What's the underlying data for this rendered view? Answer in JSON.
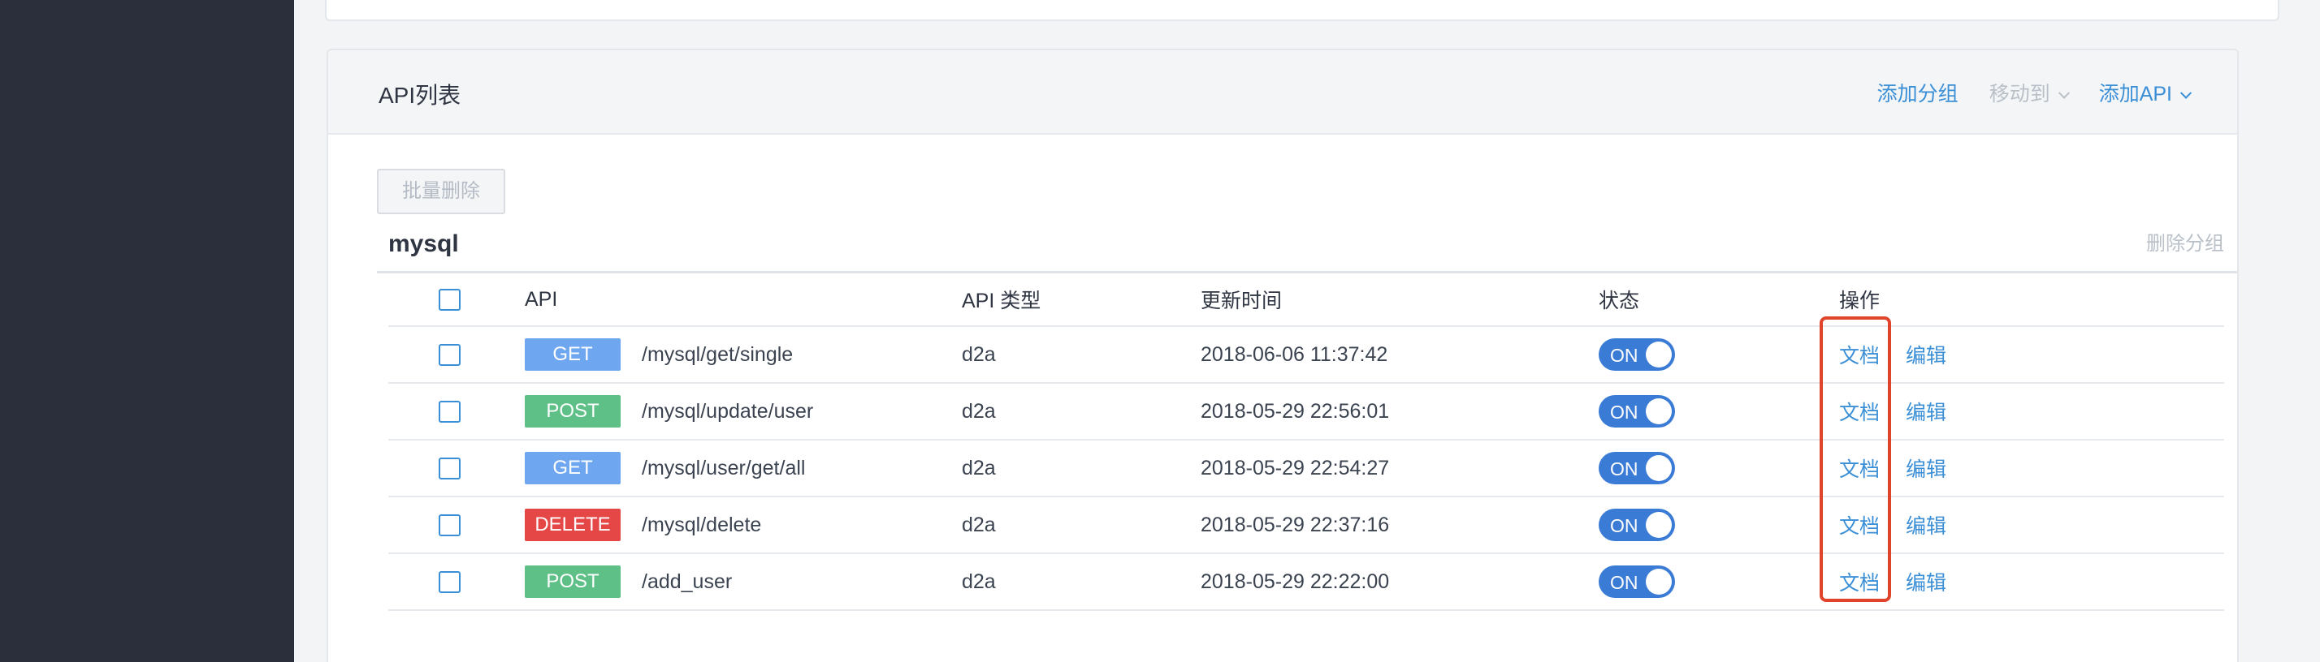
{
  "panel": {
    "title": "API列表",
    "actions": {
      "add_group": "添加分组",
      "move_to": "移动到",
      "add_api": "添加API"
    }
  },
  "toolbar": {
    "batch_delete": "批量删除"
  },
  "group": {
    "name": "mysql",
    "delete_group": "删除分组"
  },
  "table": {
    "headers": {
      "api": "API",
      "api_type": "API 类型",
      "updated": "更新时间",
      "status": "状态",
      "ops": "操作"
    },
    "rows": [
      {
        "method": "GET",
        "method_color": "#6ea7f0",
        "path": "/mysql/get/single",
        "type": "d2a",
        "updated": "2018-06-06 11:37:42",
        "status": "ON",
        "doc": "文档",
        "edit": "编辑"
      },
      {
        "method": "POST",
        "method_color": "#5ec087",
        "path": "/mysql/update/user",
        "type": "d2a",
        "updated": "2018-05-29 22:56:01",
        "status": "ON",
        "doc": "文档",
        "edit": "编辑"
      },
      {
        "method": "GET",
        "method_color": "#6ea7f0",
        "path": "/mysql/user/get/all",
        "type": "d2a",
        "updated": "2018-05-29 22:54:27",
        "status": "ON",
        "doc": "文档",
        "edit": "编辑"
      },
      {
        "method": "DELETE",
        "method_color": "#e54646",
        "path": "/mysql/delete",
        "type": "d2a",
        "updated": "2018-05-29 22:37:16",
        "status": "ON",
        "doc": "文档",
        "edit": "编辑"
      },
      {
        "method": "POST",
        "method_color": "#5ec087",
        "path": "/add_user",
        "type": "d2a",
        "updated": "2018-05-29 22:22:00",
        "status": "ON",
        "doc": "文档",
        "edit": "编辑"
      }
    ]
  },
  "colors": {
    "accent": "#3b8fd6",
    "highlight": "#e0452c",
    "sidebar": "#2a2f3b"
  }
}
